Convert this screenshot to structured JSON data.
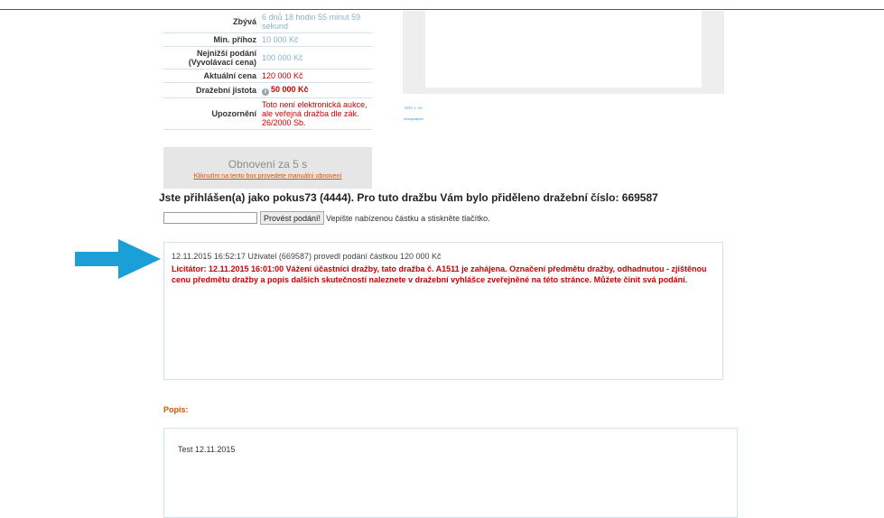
{
  "auction_info": {
    "rows": [
      {
        "label": "Zbývá",
        "value": "6 dnů 18 hodin 55 minut 59 sekund"
      },
      {
        "label": "Min. příhoz",
        "value": "10 000 Kč"
      },
      {
        "label": "Nejnižší podání (Vyvolávací cena)",
        "value": "100 000 Kč"
      },
      {
        "label": "Aktuální cena",
        "value": "120 000 Kč"
      },
      {
        "label": "Dražební jistota",
        "value": "50 000 Kč"
      },
      {
        "label": "Upozornění",
        "value": "Toto není elektronická aukce, ale veřejná dražba dle zák. 26/2000 Sb."
      }
    ]
  },
  "refresh": {
    "title": "Obnovení za 5 s",
    "link": "Kliknutím na tento box provedete manuální obnovení"
  },
  "image_area": {
    "caption_1": "TEST 1. V0",
    "caption_2": "nesupnapriv"
  },
  "login_message": "Jste přihlášen(a) jako pokus73 (4444). Pro tuto dražbu Vám bylo přiděleno dražební číslo: 669587",
  "bid_form": {
    "input_value": "",
    "button_label": "Provést podání!",
    "hint": "Vepište nabízenou částku a stiskněte tlačítko."
  },
  "log": {
    "entries": [
      {
        "text": "12.11.2015 16:52:17 Uživatel (669587) provedl podání částkou 120 000 Kč"
      },
      {
        "text": "Licitátor: 12.11.2015 16:01:00 Vážení účastníci dražby, tato dražba č. A1511 je zahájena. Označení předmětu dražby, odhadnutou - zjištěnou cenu předmětu dražby a popis dalších skutečností naleznete v dražební vyhlášce zveřejněné na této stránce. Můžete činit svá podání."
      }
    ]
  },
  "description": {
    "label": "Popis:",
    "text": "Test 12.11.2015"
  },
  "colors": {
    "accent_red": "#cc0000",
    "link_orange": "#d35400",
    "muted_blue": "#8ab4c4",
    "arrow_blue": "#1a9fd6",
    "border_blue": "#cfe3ef"
  }
}
